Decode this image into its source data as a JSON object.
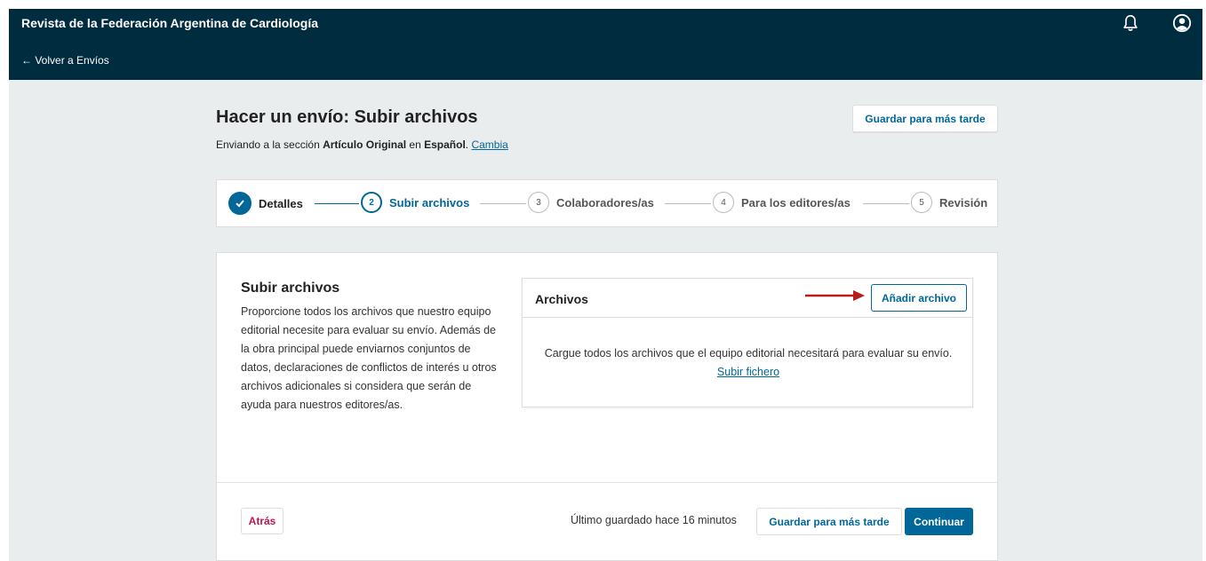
{
  "header": {
    "site_title": "Revista de la Federación Argentina de Cardiología",
    "back_link": "← Volver a Envíos",
    "icons": [
      "bell-icon",
      "user-circle-icon"
    ]
  },
  "page": {
    "title": "Hacer un envío: Subir archivos",
    "section_prefix": "Enviando a la sección ",
    "section_name": "Artículo Original",
    "section_mid": " en ",
    "language": "Español",
    "section_suffix": ". ",
    "change_link": "Cambia",
    "save_later_label": "Guardar para más tarde"
  },
  "steps": [
    {
      "number": "",
      "label": "Detalles",
      "state": "done"
    },
    {
      "number": "2",
      "label": "Subir archivos",
      "state": "current"
    },
    {
      "number": "3",
      "label": "Colaboradores/as",
      "state": "pending"
    },
    {
      "number": "4",
      "label": "Para los editores/as",
      "state": "pending"
    },
    {
      "number": "5",
      "label": "Revisión",
      "state": "pending"
    }
  ],
  "upload": {
    "heading": "Subir archivos",
    "description": "Proporcione todos los archivos que nuestro equipo editorial necesite para evaluar su envío. Además de la obra principal puede enviarnos conjuntos de datos, declaraciones de conflictos de interés u otros archivos adicionales si considera que serán de ayuda para nuestros editores/as."
  },
  "files": {
    "title": "Archivos",
    "add_button": "Añadir archivo",
    "empty_text": "Cargue todos los archivos que el equipo editorial necesitará para evaluar su envío. ",
    "upload_link": "Subir fichero"
  },
  "footer": {
    "back_button": "Atrás",
    "last_saved": "Último guardado hace 16 minutos",
    "save_later_button": "Guardar para más tarde",
    "continue_button": "Continuar"
  },
  "colors": {
    "header_bg": "#002c40",
    "accent": "#006798",
    "back_button_text": "#c1144d",
    "arrow": "#b71c1c"
  }
}
